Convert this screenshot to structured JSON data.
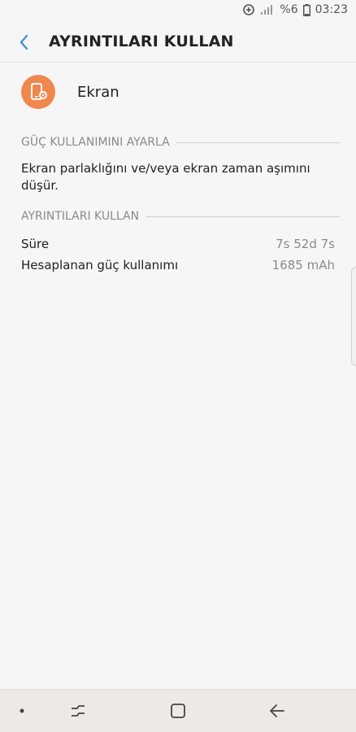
{
  "status_bar": {
    "time": "03:23",
    "battery_percent": "%6",
    "icons": [
      "data-saver-icon",
      "signal-icon",
      "battery-icon"
    ]
  },
  "header": {
    "title": "AYRINTILARI KULLAN",
    "back_icon": "chevron-left-icon"
  },
  "app": {
    "name": "Ekran",
    "icon": "screen-settings-icon",
    "icon_color": "#f0884e"
  },
  "sections": {
    "adjust": {
      "title": "GÜÇ KULLANIMINI AYARLA",
      "description": "Ekran parlaklığını ve/veya ekran zaman aşımını düşür."
    },
    "details": {
      "title": "AYRINTILARI KULLAN",
      "rows": [
        {
          "label": "Süre",
          "value": "7s 52d 7s"
        },
        {
          "label": "Hesaplanan güç kullanımı",
          "value": "1685 mAh"
        }
      ]
    }
  },
  "nav_bar": {
    "items": [
      "dot-icon",
      "recents-icon",
      "home-icon",
      "back-icon"
    ]
  },
  "colors": {
    "accent": "#3d8ec9",
    "background": "#f7f6f6",
    "nav_background": "#efe9e6"
  }
}
